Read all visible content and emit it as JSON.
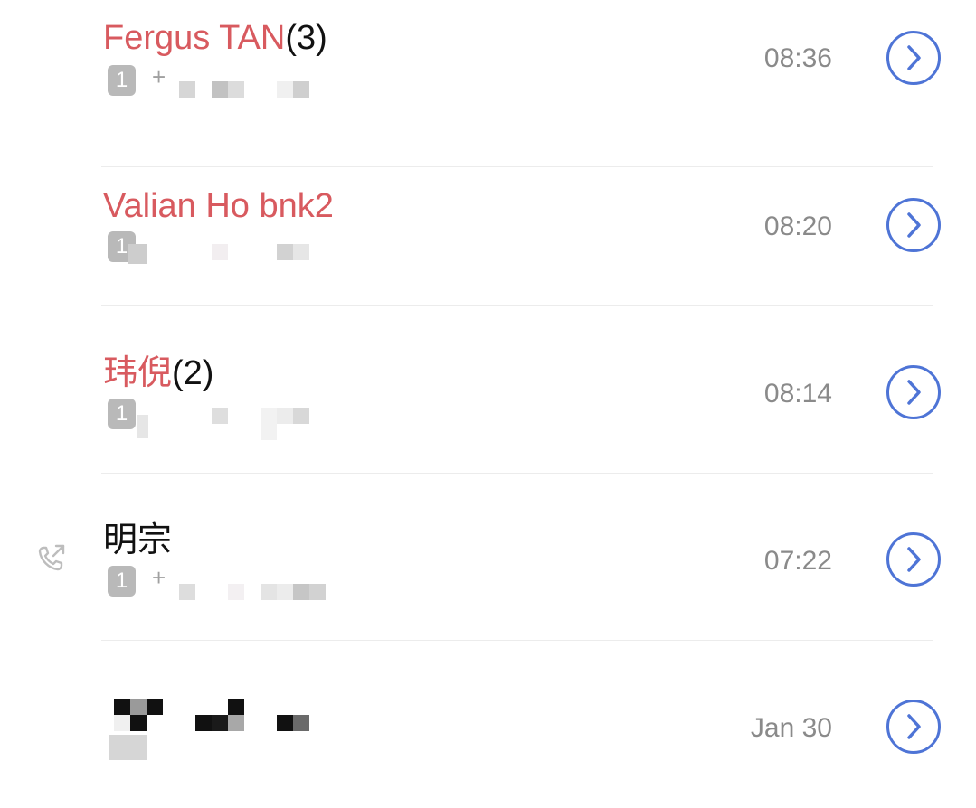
{
  "call_log": {
    "entries": [
      {
        "name": "Fergus TAN",
        "count": "(3)",
        "missed": true,
        "sim": "1",
        "number_visible_prefix": "+",
        "time": "08:36",
        "outgoing": false
      },
      {
        "name": "Valian Ho bnk2",
        "count": "",
        "missed": true,
        "sim": "1",
        "number_visible_prefix": "",
        "time": "08:20",
        "outgoing": false
      },
      {
        "name": "玮倪",
        "count": "(2)",
        "missed": true,
        "sim": "1",
        "number_visible_prefix": "",
        "time": "08:14",
        "outgoing": false
      },
      {
        "name": "明宗",
        "count": "",
        "missed": false,
        "sim": "1",
        "number_visible_prefix": "+",
        "time": "07:22",
        "outgoing": true
      },
      {
        "name": "",
        "count": "",
        "missed": false,
        "sim": "",
        "number_visible_prefix": "",
        "time": "Jan 30",
        "outgoing": false
      }
    ]
  },
  "icons": {
    "detail": "chevron-right-circle-icon",
    "outgoing": "outgoing-call-icon"
  },
  "colors": {
    "missed_name": "#d85a5f",
    "normal_name": "#111111",
    "time": "#8a8a8a",
    "accent": "#4e74d6",
    "sim_badge": "#b9b9b9"
  }
}
